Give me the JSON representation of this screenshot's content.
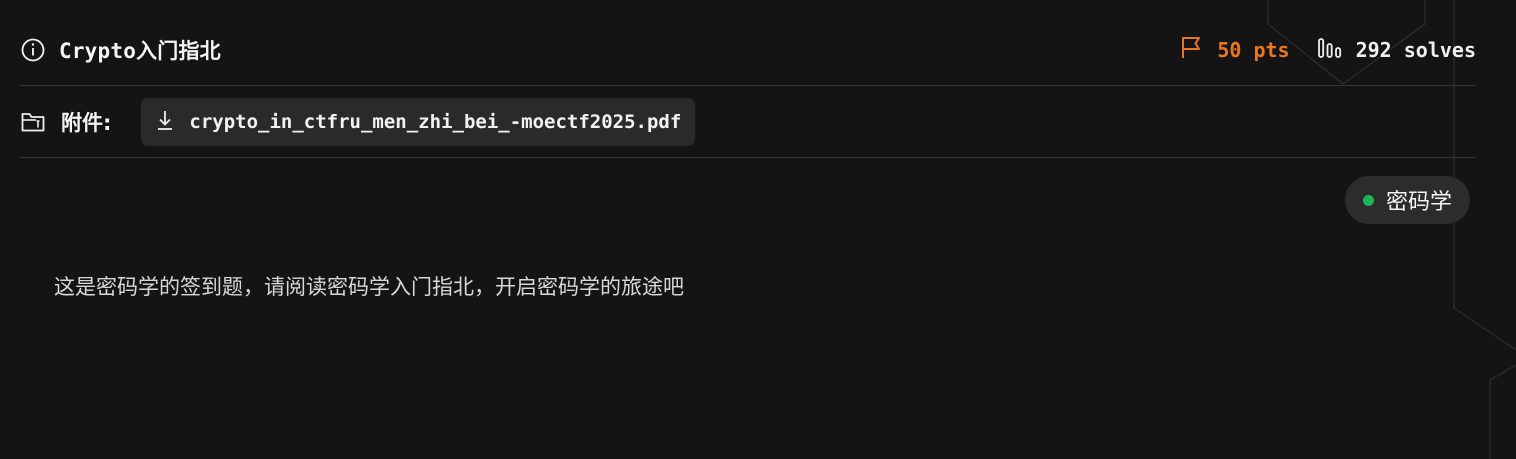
{
  "challenge": {
    "title": "Crypto入门指北",
    "points": "50 pts",
    "solves": "292 solves"
  },
  "attachment": {
    "label": "附件:",
    "file_name": "crypto_in_ctfru_men_zhi_bei_-moectf2025.pdf"
  },
  "tag": {
    "label": "密码学",
    "dot_color": "#1fb45a"
  },
  "description": "这是密码学的签到题，请阅读密码学入门指北，开启密码学的旅途吧",
  "colors": {
    "background": "#141414",
    "points": "#e8761f",
    "divider": "#363636",
    "chip": "#2a2a2a"
  },
  "icons": {
    "title": "info-icon",
    "points": "flag-icon",
    "solves": "bar-chart-icon",
    "attachment": "folder-icon",
    "download": "download-icon"
  }
}
